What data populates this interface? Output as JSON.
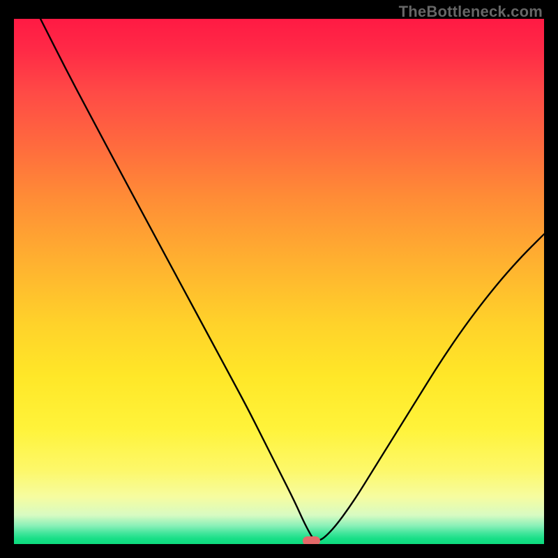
{
  "watermark": "TheBottleneck.com",
  "colors": {
    "frame": "#000000",
    "curve": "#000000",
    "min_marker": "#e46a6a"
  },
  "chart_data": {
    "type": "line",
    "title": "",
    "xlabel": "",
    "ylabel": "",
    "xlim": [
      0,
      100
    ],
    "ylim": [
      0,
      100
    ],
    "grid": false,
    "legend": false,
    "min_marker_x": 56,
    "series": [
      {
        "name": "bottleneck-curve",
        "x": [
          5,
          10,
          15,
          20,
          24,
          28,
          32,
          36,
          40,
          44,
          47,
          50,
          53,
          55,
          57,
          60,
          64,
          68,
          72,
          76,
          80,
          84,
          88,
          92,
          96,
          100
        ],
        "y": [
          100,
          90,
          80.5,
          71,
          63.5,
          56,
          48.5,
          41,
          33.5,
          26,
          20,
          14,
          8,
          3.5,
          0,
          2.5,
          8,
          14.5,
          21,
          27.5,
          34,
          40,
          45.5,
          50.5,
          55,
          59
        ]
      }
    ],
    "annotations": []
  }
}
